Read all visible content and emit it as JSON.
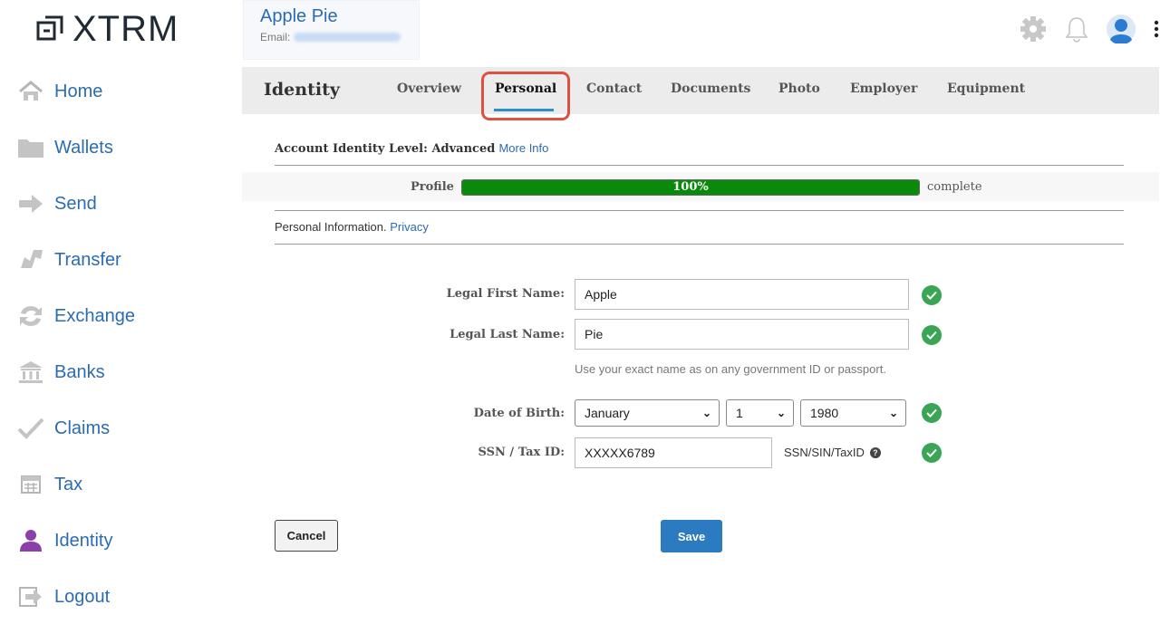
{
  "brand": {
    "name": "XTRM"
  },
  "sidebar": {
    "items": [
      {
        "label": "Home",
        "icon": "home-icon"
      },
      {
        "label": "Wallets",
        "icon": "folder-icon"
      },
      {
        "label": "Send",
        "icon": "arrow-right-icon"
      },
      {
        "label": "Transfer",
        "icon": "transfer-icon"
      },
      {
        "label": "Exchange",
        "icon": "exchange-icon"
      },
      {
        "label": "Banks",
        "icon": "bank-icon"
      },
      {
        "label": "Claims",
        "icon": "checkmark-icon"
      },
      {
        "label": "Tax",
        "icon": "calculator-icon"
      },
      {
        "label": "Identity",
        "icon": "person-icon"
      },
      {
        "label": "Logout",
        "icon": "logout-icon"
      }
    ]
  },
  "header": {
    "user_name": "Apple Pie",
    "email_label": "Email:"
  },
  "tabs": {
    "title": "Identity",
    "items": [
      {
        "label": "Overview"
      },
      {
        "label": "Personal"
      },
      {
        "label": "Contact"
      },
      {
        "label": "Documents"
      },
      {
        "label": "Photo"
      },
      {
        "label": "Employer"
      },
      {
        "label": "Equipment"
      }
    ],
    "active": "Personal"
  },
  "identity_level": {
    "label": "Account Identity Level: Advanced",
    "link": "More Info"
  },
  "progress": {
    "label": "Profile",
    "value": 1.0,
    "text": "100%",
    "after": "complete"
  },
  "section": {
    "label": "Personal Information.",
    "link": "Privacy"
  },
  "form": {
    "first_name_label": "Legal First Name:",
    "first_name_value": "Apple",
    "last_name_label": "Legal Last Name:",
    "last_name_value": "Pie",
    "name_hint": "Use your exact name as on any government ID or passport.",
    "dob_label": "Date of Birth:",
    "dob_month": "January",
    "dob_day": "1",
    "dob_year": "1980",
    "ssn_label": "SSN / Tax ID:",
    "ssn_value": "XXXXX6789",
    "ssn_hint": "SSN/SIN/TaxID"
  },
  "buttons": {
    "cancel": "Cancel",
    "save": "Save"
  },
  "colors": {
    "accent": "#2b6cb0",
    "progress": "#0a8a0a",
    "check": "#3aa655",
    "highlight": "#e05040",
    "identity_icon": "#8b3fa8"
  }
}
